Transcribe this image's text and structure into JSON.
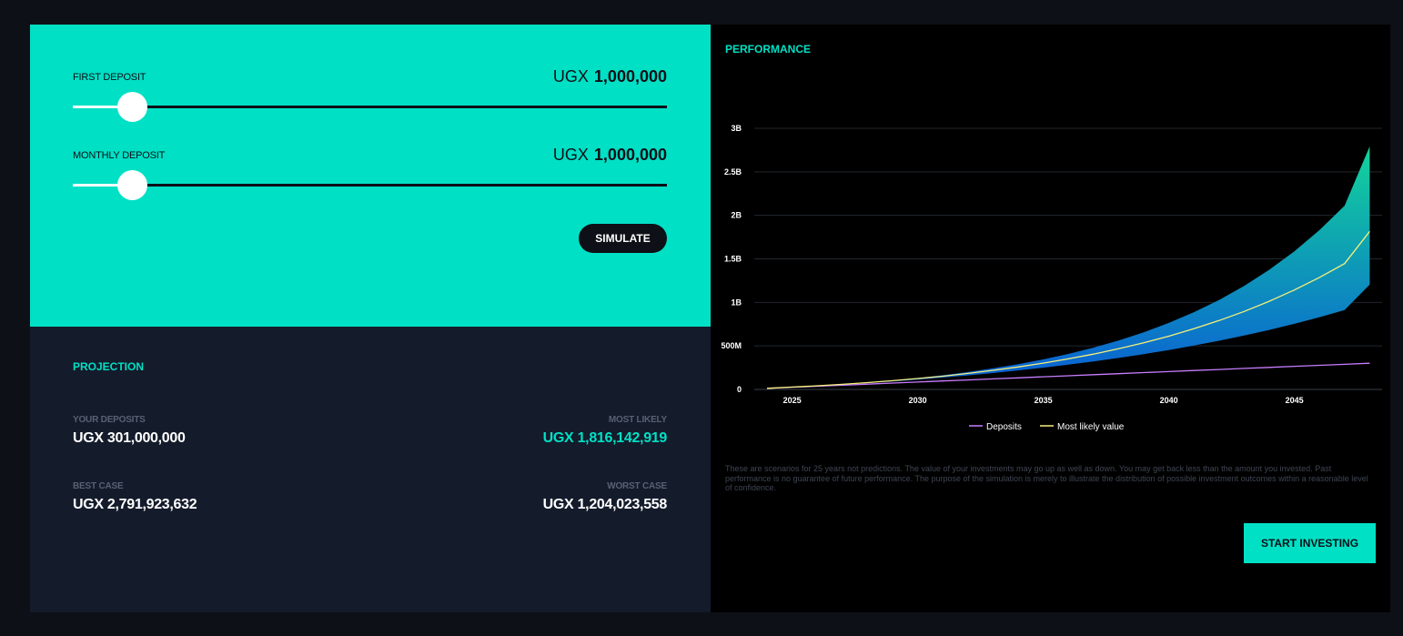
{
  "inputs": {
    "first_deposit": {
      "label": "FIRST DEPOSIT",
      "currency": "UGX",
      "amount": "1,000,000",
      "slider_fraction": 0.1
    },
    "monthly_deposit": {
      "label": "MONTHLY DEPOSIT",
      "currency": "UGX",
      "amount": "1,000,000",
      "slider_fraction": 0.1
    },
    "simulate_label": "SIMULATE"
  },
  "projection": {
    "title": "PROJECTION",
    "your_deposits": {
      "label": "YOUR DEPOSITS",
      "value": "UGX 301,000,000"
    },
    "most_likely": {
      "label": "MOST LIKELY",
      "value": "UGX 1,816,142,919"
    },
    "best_case": {
      "label": "BEST CASE",
      "value": "UGX 2,791,923,632"
    },
    "worst_case": {
      "label": "WORST CASE",
      "value": "UGX 1,204,023,558"
    }
  },
  "performance": {
    "title": "PERFORMANCE",
    "disclaimer": "These are scenarios for 25 years not predictions. The value of your investments may go up as well as down. You may get back less than the amount you invested. Past performance is no guarantee of future performance. The purpose of the simulation is merely to illustrate the distribution of possible investment outcomes within a reasonable level of confidence.",
    "start_label": "START INVESTING"
  },
  "colors": {
    "accent": "#00e0c5",
    "deposits": "#c77dff",
    "most_likely": "#f5f07a",
    "band_top": "#12d49a",
    "band_bottom": "#0a5cd6"
  },
  "chart_data": {
    "type": "area",
    "x": [
      2024,
      2025,
      2026,
      2027,
      2028,
      2029,
      2030,
      2031,
      2032,
      2033,
      2034,
      2035,
      2036,
      2037,
      2038,
      2039,
      2040,
      2041,
      2042,
      2043,
      2044,
      2045,
      2046,
      2047,
      2048
    ],
    "xticks": [
      2025,
      2030,
      2035,
      2040,
      2045
    ],
    "yticks": [
      0,
      500000000,
      1000000000,
      1500000000,
      2000000000,
      2500000000,
      3000000000
    ],
    "ytick_labels": [
      "0",
      "500M",
      "1B",
      "1.5B",
      "2B",
      "2.5B",
      "3B"
    ],
    "ylim": [
      0,
      3000000000
    ],
    "grid": true,
    "legend": "bottom",
    "series": [
      {
        "name": "Deposits",
        "values": [
          13000000,
          25000000,
          37000000,
          49000000,
          61000000,
          73000000,
          85000000,
          97000000,
          109000000,
          121000000,
          133000000,
          145000000,
          157000000,
          169000000,
          181000000,
          193000000,
          205000000,
          217000000,
          229000000,
          241000000,
          253000000,
          265000000,
          277000000,
          289000000,
          301000000
        ]
      },
      {
        "name": "Most likely value",
        "values": [
          13000000,
          27000000,
          42000000,
          59000000,
          78000000,
          100000000,
          125000000,
          152000000,
          184000000,
          219000000,
          258000000,
          302000000,
          351000000,
          406000000,
          467000000,
          536000000,
          612000000,
          697000000,
          791000000,
          896000000,
          1013000000,
          1143000000,
          1287000000,
          1446000000,
          1816000000
        ]
      }
    ],
    "band": {
      "upper": [
        13000000,
        27000000,
        42000000,
        60000000,
        81000000,
        105000000,
        132000000,
        163000000,
        200000000,
        242000000,
        290000000,
        345000000,
        408000000,
        480000000,
        562000000,
        656000000,
        764000000,
        887000000,
        1028000000,
        1190000000,
        1375000000,
        1587000000,
        1830000000,
        2110000000,
        2792000000
      ],
      "lower": [
        13000000,
        26000000,
        40000000,
        56000000,
        73000000,
        92000000,
        113000000,
        136000000,
        161000000,
        188000000,
        218000000,
        250000000,
        285000000,
        322000000,
        362000000,
        406000000,
        453000000,
        504000000,
        559000000,
        619000000,
        684000000,
        754000000,
        830000000,
        912000000,
        1204000000
      ]
    }
  }
}
